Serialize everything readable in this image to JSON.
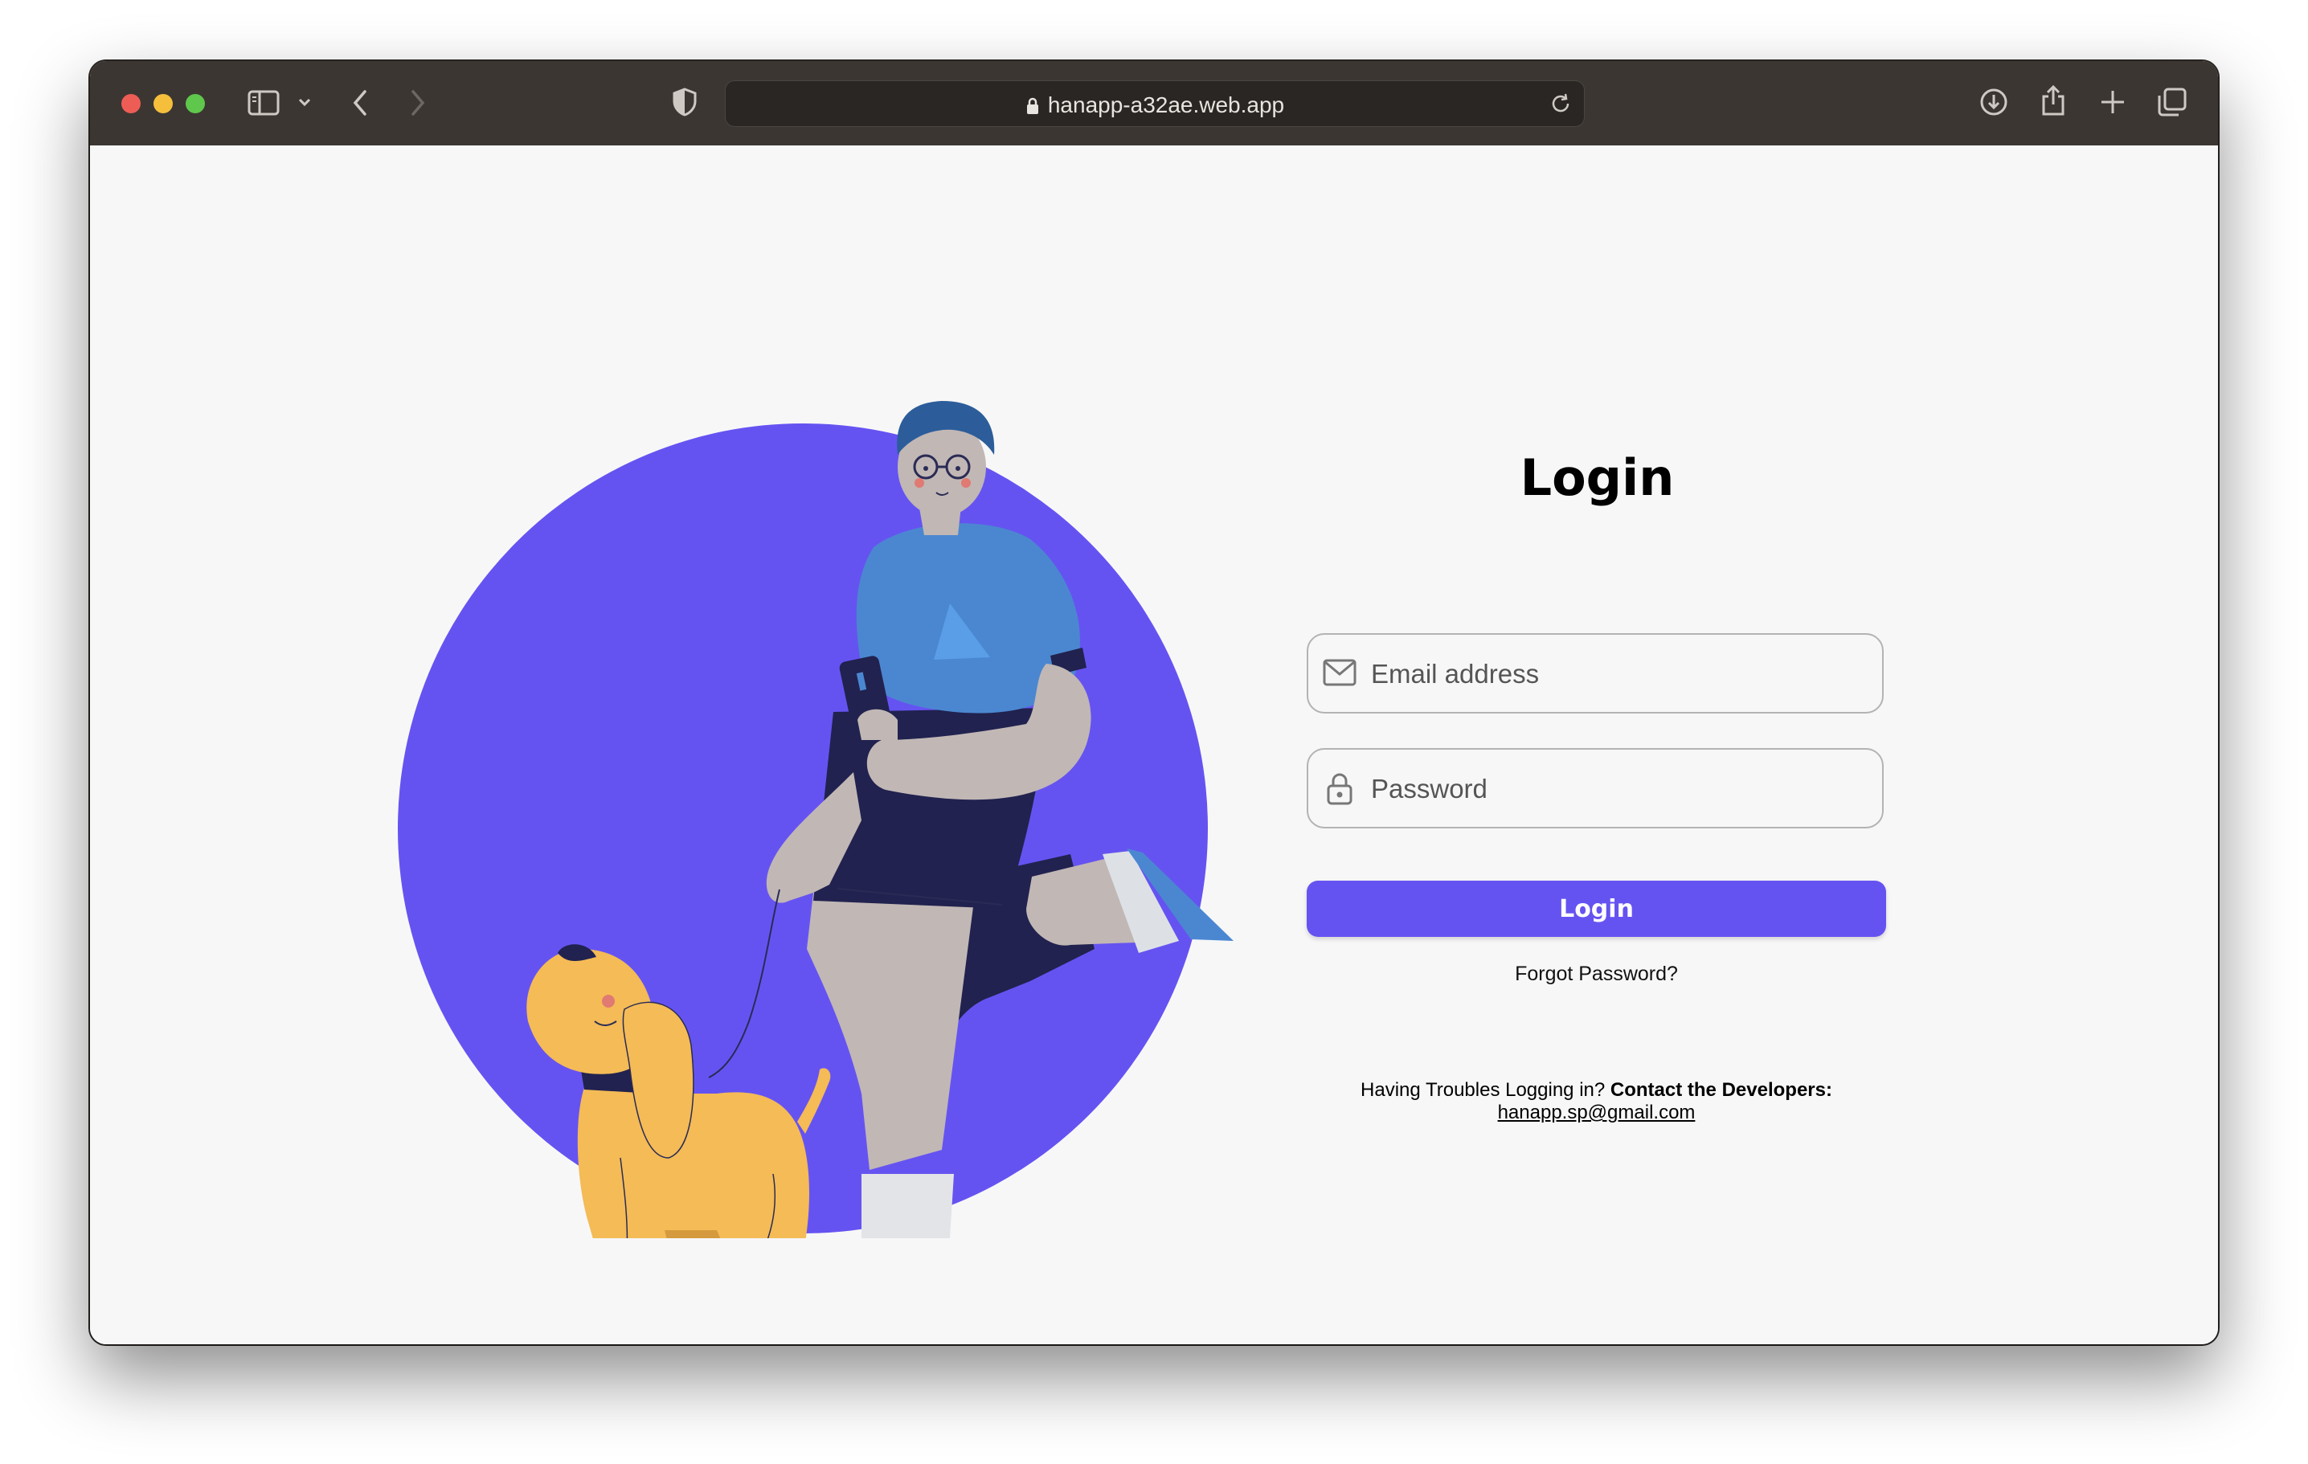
{
  "browser": {
    "url": "hanapp-a32ae.web.app"
  },
  "login": {
    "title": "Login",
    "email_placeholder": "Email address",
    "password_placeholder": "Password",
    "button_label": "Login",
    "forgot_password": "Forgot Password?"
  },
  "help": {
    "prefix": "Having Troubles Logging in?",
    "contact_bold": "Contact the Developers:",
    "email": "hanapp.sp@gmail.com"
  },
  "colors": {
    "accent": "#6553f1",
    "toolbar": "#3b3632",
    "background": "#f7f7f8"
  },
  "icons": {
    "sidebar": "sidebar-icon",
    "back": "chevron-left-icon",
    "forward": "chevron-right-icon",
    "shield": "shield-icon",
    "lock": "lock-icon",
    "reload": "reload-icon",
    "download": "download-icon",
    "share": "share-icon",
    "new_tab": "plus-icon",
    "tabs": "tabs-overview-icon",
    "email_field": "envelope-icon",
    "password_field": "padlock-icon"
  }
}
